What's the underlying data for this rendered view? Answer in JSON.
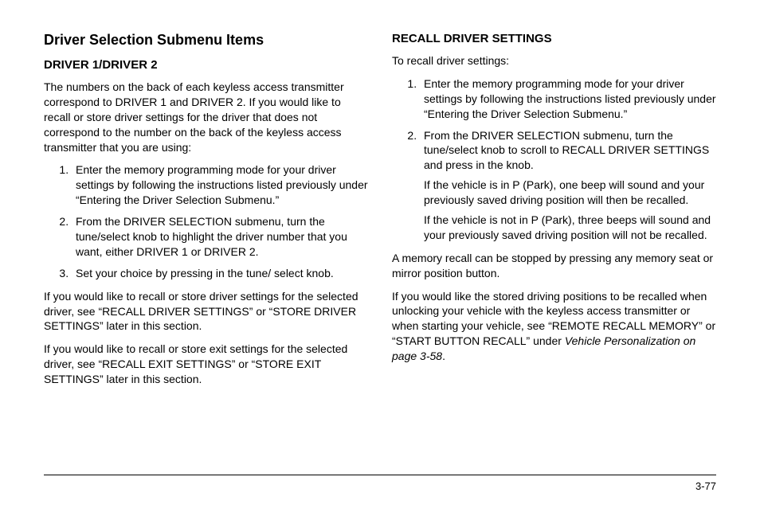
{
  "left": {
    "h1": "Driver Selection Submenu Items",
    "h2": "DRIVER 1/DRIVER 2",
    "intro": "The numbers on the back of each keyless access transmitter correspond to DRIVER 1 and DRIVER 2. If you would like to recall or store driver settings for the driver that does not correspond to the number on the back of the keyless access transmitter that you are using:",
    "steps": [
      "Enter the memory programming mode for your driver settings by following the instructions listed previously under “Entering the Driver Selection Submenu.”",
      "From the DRIVER SELECTION submenu, turn the tune/select knob to highlight the driver number that you want, either DRIVER 1 or DRIVER 2.",
      "Set your choice by pressing in the tune/ select knob."
    ],
    "after1": "If you would like to recall or store driver settings for the selected driver, see “RECALL DRIVER SETTINGS” or “STORE DRIVER SETTINGS” later in this section.",
    "after2": "If you would like to recall or store exit settings for the selected driver, see “RECALL EXIT SETTINGS” or “STORE EXIT SETTINGS” later in this section."
  },
  "right": {
    "h2": "RECALL DRIVER SETTINGS",
    "intro": "To recall driver settings:",
    "steps": [
      {
        "text": "Enter the memory programming mode for your driver settings by following the instructions listed previously under “Entering the Driver Selection Submenu.”",
        "notes": []
      },
      {
        "text": "From the DRIVER SELECTION submenu, turn the tune/select knob to scroll to RECALL DRIVER SETTINGS and press in the knob.",
        "notes": [
          "If the vehicle is in P (Park), one beep will sound and your previously saved driving position will then be recalled.",
          "If the vehicle is not in P (Park), three beeps will sound and your previously saved driving position will not be recalled."
        ]
      }
    ],
    "after1": "A memory recall can be stopped by pressing any memory seat or mirror position button.",
    "after2_pre": "If you would like the stored driving positions to be recalled when unlocking your vehicle with the keyless access transmitter or when starting your vehicle, see “REMOTE RECALL MEMORY” or “START BUTTON RECALL” under ",
    "after2_italic": "Vehicle Personalization on page 3-58",
    "after2_post": "."
  },
  "pageNumber": "3-77"
}
